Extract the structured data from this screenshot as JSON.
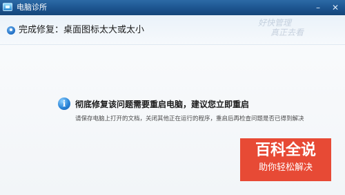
{
  "window": {
    "title": "电脑诊所",
    "buttons": [
      "minimize-icon",
      "close-icon"
    ]
  },
  "status": {
    "title": "完成修复：桌面图标太大或太小",
    "icon": "check-circle-icon"
  },
  "watermark": {
    "line1": "好快管理",
    "line2": "真正去看"
  },
  "message": {
    "icon": "info-icon",
    "main": "彻底修复该问题需要重启电脑，建议您立即重启",
    "sub": "请保存电脑上打开的文档，关闭其他正在运行的程序，重启后再检查问题是否已得到解决"
  },
  "logo": {
    "text": "百科全说",
    "subtext": "助你轻松解决",
    "color": "#e74a35"
  },
  "colors": {
    "titlebar": "#1c548f",
    "accent": "#2b85d8"
  }
}
